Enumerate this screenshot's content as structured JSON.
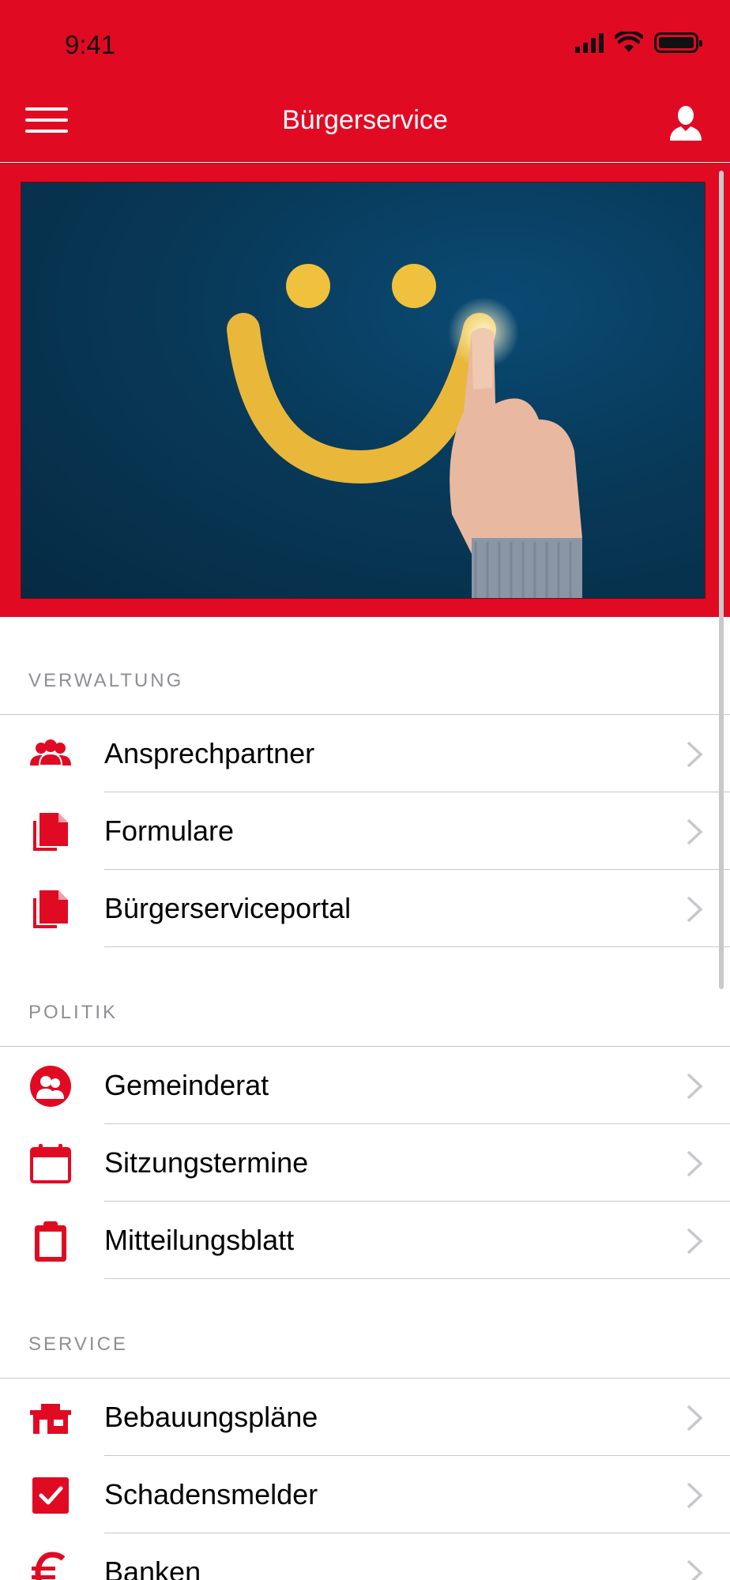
{
  "status_bar": {
    "time": "9:41"
  },
  "nav": {
    "title": "Bürgerservice"
  },
  "sections": [
    {
      "title": "VERWALTUNG",
      "items": [
        {
          "label": "Ansprechpartner",
          "icon": "people-icon"
        },
        {
          "label": "Formulare",
          "icon": "documents-icon"
        },
        {
          "label": "Bürgerserviceportal",
          "icon": "documents-icon"
        }
      ]
    },
    {
      "title": "POLITIK",
      "items": [
        {
          "label": "Gemeinderat",
          "icon": "council-icon"
        },
        {
          "label": "Sitzungstermine",
          "icon": "calendar-icon"
        },
        {
          "label": "Mitteilungsblatt",
          "icon": "clipboard-icon"
        }
      ]
    },
    {
      "title": "SERVICE",
      "items": [
        {
          "label": "Bebauungspläne",
          "icon": "building-icon"
        },
        {
          "label": "Schadensmelder",
          "icon": "checkbox-icon"
        },
        {
          "label": "Banken",
          "icon": "euro-icon"
        }
      ]
    }
  ],
  "colors": {
    "brand": "#e10a23",
    "separator": "#c8c7cc",
    "section_text": "#8e8e93"
  }
}
